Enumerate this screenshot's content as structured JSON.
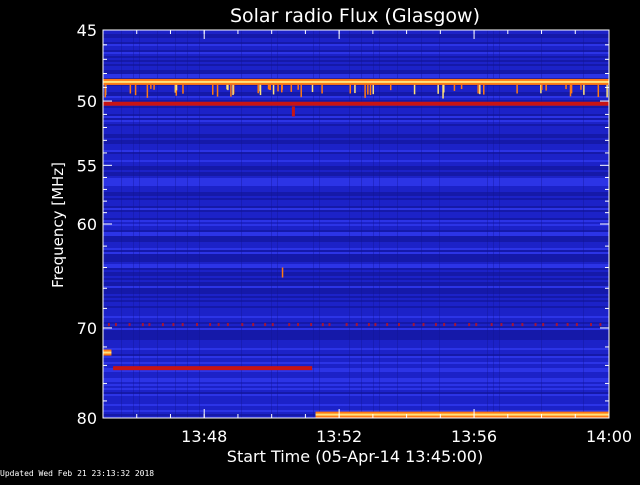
{
  "footer": {
    "updated": "Updated Wed Feb 21 23:13:32 2018"
  },
  "colors": {
    "background": "#000000",
    "plot_base": "#1c22c8",
    "band_dark": "#10138f",
    "band_light": "#3a44ff",
    "hot_red": "#c81414",
    "hot_orange": "#ff7a14",
    "hot_yellow": "#ffe27a",
    "axis": "#ffffff"
  },
  "chart_data": {
    "type": "heatmap",
    "title": "Solar radio Flux (Glasgow)",
    "xlabel": "Start Time (05-Apr-14 13:45:00)",
    "ylabel": "Frequency [MHz]",
    "x_unit": "minutes after 13:45:00",
    "xlim": [
      0,
      15
    ],
    "ylim": [
      80,
      45
    ],
    "y_scale": "log",
    "x_ticks": [
      {
        "value": 3,
        "label": "13:48"
      },
      {
        "value": 7,
        "label": "13:52"
      },
      {
        "value": 11,
        "label": "13:56"
      },
      {
        "value": 15,
        "label": "14:00"
      }
    ],
    "y_ticks": [
      {
        "value": 45,
        "label": "45"
      },
      {
        "value": 50,
        "label": "50"
      },
      {
        "value": 55,
        "label": "55"
      },
      {
        "value": 60,
        "label": "60"
      },
      {
        "value": 70,
        "label": "70"
      },
      {
        "value": 80,
        "label": "80"
      }
    ],
    "features": [
      {
        "kind": "line",
        "freq": 48.6,
        "x0": 0,
        "x1": 15,
        "intensity": "very_high"
      },
      {
        "kind": "line",
        "freq": 50.2,
        "x0": 0,
        "x1": 15,
        "intensity": "high"
      },
      {
        "kind": "line",
        "freq": 74.3,
        "x0": 0.3,
        "x1": 6.2,
        "intensity": "high"
      },
      {
        "kind": "line",
        "freq": 79.6,
        "x0": 6.3,
        "x1": 15,
        "intensity": "very_high"
      },
      {
        "kind": "line",
        "freq": 72.6,
        "x0": 0,
        "x1": 0.25,
        "intensity": "very_high"
      }
    ]
  }
}
